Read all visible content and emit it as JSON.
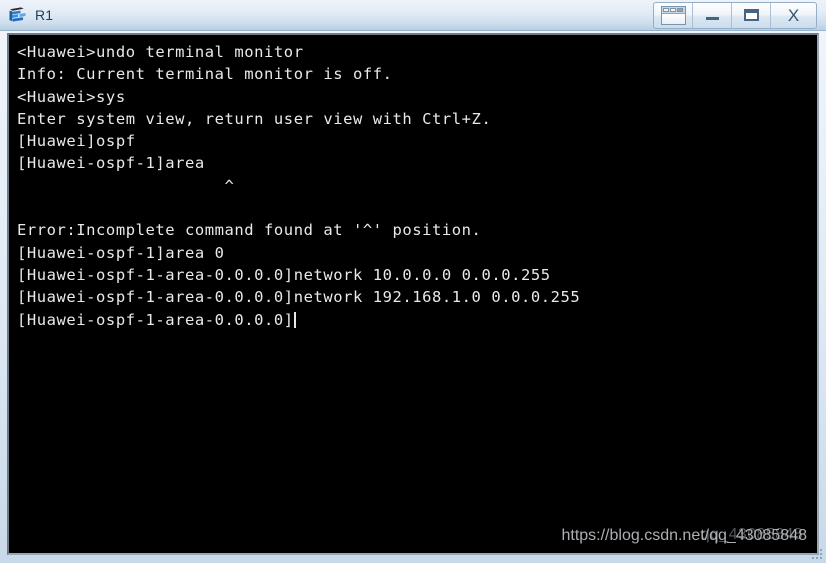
{
  "window": {
    "title": "R1",
    "icon": "router-device-icon",
    "controls": [
      {
        "name": "panel-toggle-button",
        "label": "",
        "icon": "panel-window-icon"
      },
      {
        "name": "minimize-button",
        "label": "—",
        "icon": "minimize-icon"
      },
      {
        "name": "maximize-button",
        "label": "□",
        "icon": "maximize-icon"
      },
      {
        "name": "close-button",
        "label": "X",
        "icon": "close-icon"
      }
    ]
  },
  "terminal": {
    "background_color": "#000000",
    "text_color": "#e9e9e9",
    "lines": [
      "<Huawei>undo terminal monitor",
      "Info: Current terminal monitor is off.",
      "<Huawei>sys",
      "Enter system view, return user view with Ctrl+Z.",
      "[Huawei]ospf",
      "[Huawei-ospf-1]area",
      "                     ^",
      "",
      "Error:Incomplete command found at '^' position.",
      "[Huawei-ospf-1]area 0",
      "[Huawei-ospf-1-area-0.0.0.0]network 10.0.0.0 0.0.0.255",
      "[Huawei-ospf-1-area-0.0.0.0]network 192.168.1.0 0.0.0.255",
      "[Huawei-ospf-1-area-0.0.0.0]"
    ],
    "prompt_last": "[Huawei-ospf-1-area-0.0.0.0]",
    "cursor_visible": true
  },
  "watermark": {
    "text": "https://blog.csdn.net/qq_43085848",
    "ghost_text": "qq_43085848"
  }
}
